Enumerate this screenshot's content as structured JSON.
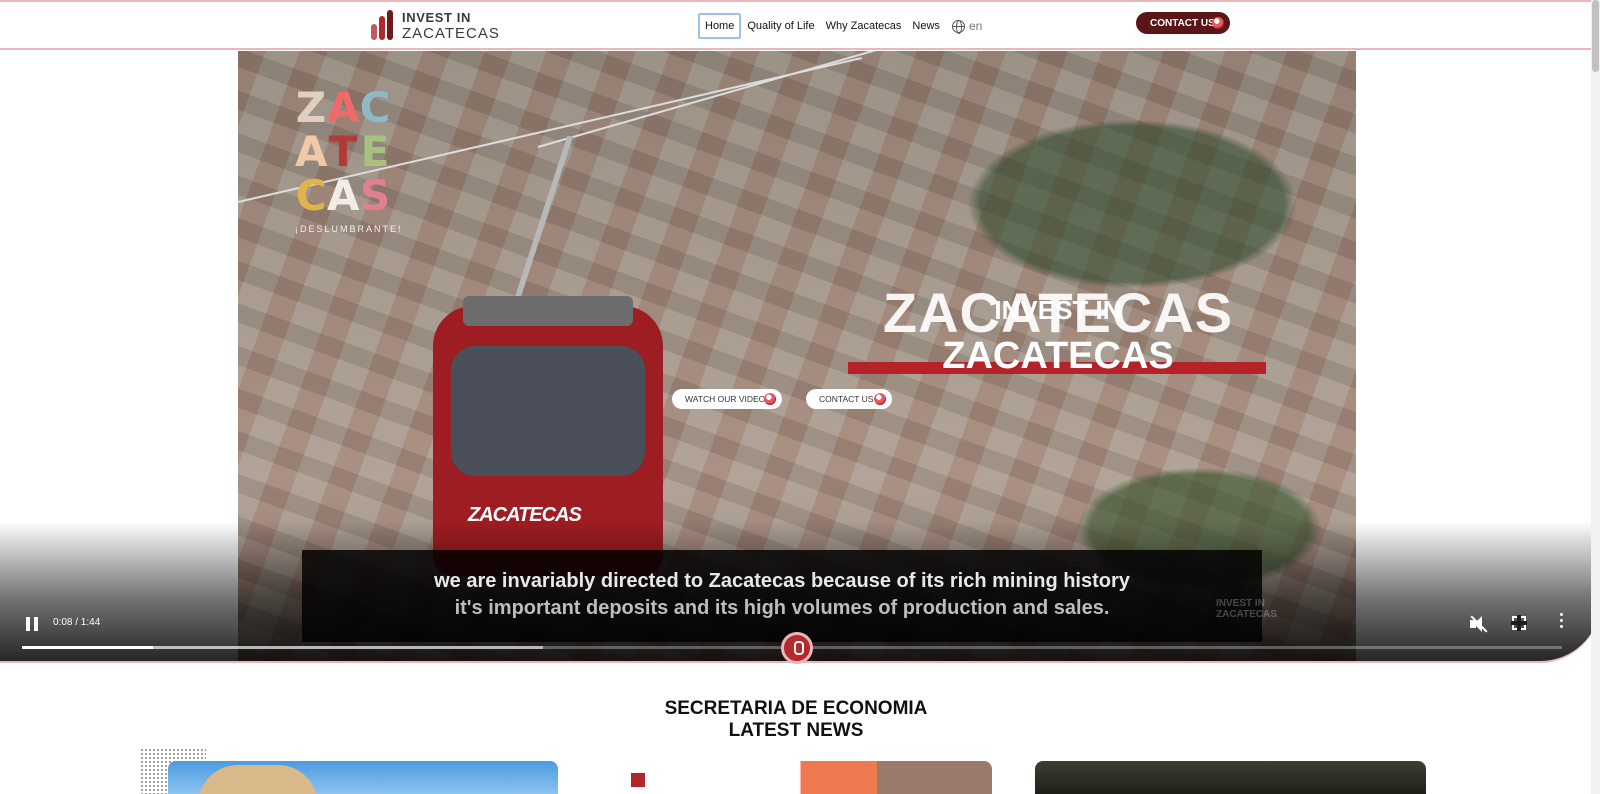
{
  "header": {
    "logo": {
      "line1": "INVEST IN",
      "line2": "ZACATECAS"
    },
    "nav": [
      {
        "label": "Home",
        "active": true
      },
      {
        "label": "Quality of Life"
      },
      {
        "label": "Why Zacatecas"
      },
      {
        "label": "News"
      }
    ],
    "language": "en",
    "contact_label": "CONTACT US"
  },
  "hero": {
    "brand_logo": {
      "letters": [
        "Z",
        "A",
        "C",
        "A",
        "T",
        "E",
        "C",
        "A",
        "S"
      ],
      "tagline": "¡DESLUMBRANTE!"
    },
    "cabin_brand": "ZACATECAS",
    "title_background": "ZACATECAS",
    "title_line1": "INVEST IN",
    "title_line2": "ZACATECAS",
    "buttons": {
      "video": "WATCH OUR VIDEO",
      "contact": "CONTACT US"
    },
    "captions": {
      "line1": "we are invariably directed to Zacatecas because of its rich mining history",
      "line2": "it's important deposits and its high volumes of production and sales."
    },
    "player": {
      "time": "0:08 / 1:44",
      "played_fraction": 0.085,
      "buffered_fraction": 0.338,
      "state": "playing",
      "muted": true
    },
    "watermark": {
      "line1": "INVEST IN",
      "line2": "ZACATECAS"
    }
  },
  "news": {
    "heading_line1": "SECRETARIA DE ECONOMIA",
    "heading_line2": "LATEST NEWS"
  },
  "colors": {
    "accent": "#b52228",
    "dark_red": "#5b1519",
    "border_pink": "#e9b7b9",
    "focus_blue": "#9dc1e8"
  },
  "icons": [
    "globe-icon",
    "pause-icon",
    "mute-icon",
    "fullscreen-icon",
    "more-options-icon",
    "scroll-down-icon"
  ]
}
